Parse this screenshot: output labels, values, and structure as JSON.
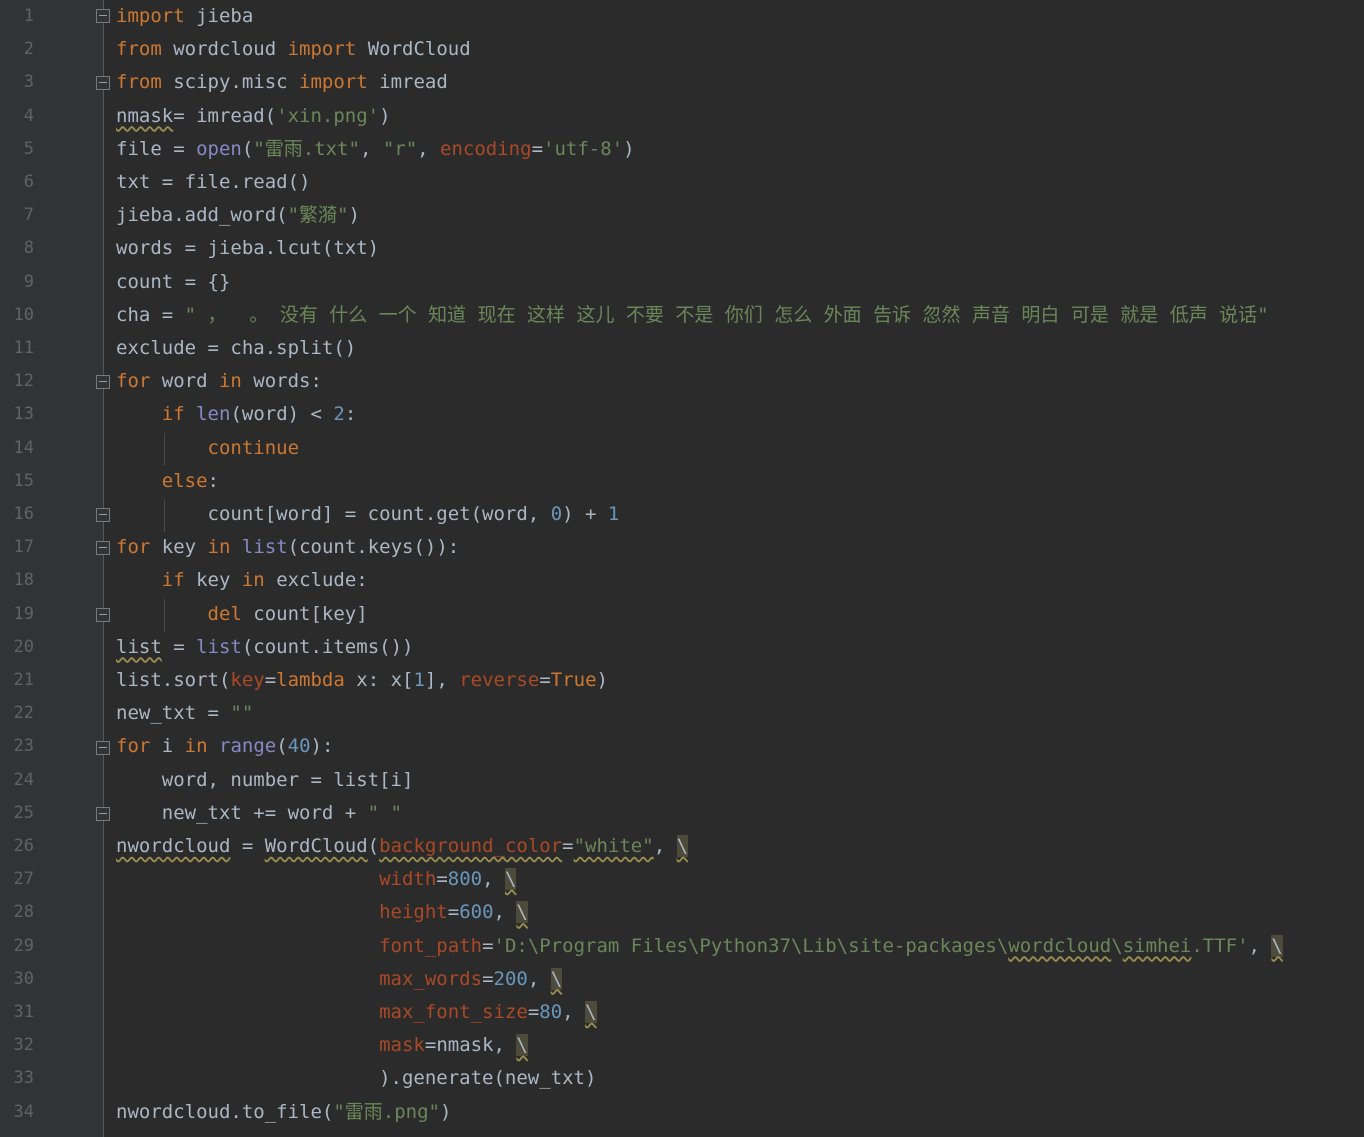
{
  "editor": {
    "line_numbers": [
      "1",
      "2",
      "3",
      "4",
      "5",
      "6",
      "7",
      "8",
      "9",
      "10",
      "11",
      "12",
      "13",
      "14",
      "15",
      "16",
      "17",
      "18",
      "19",
      "20",
      "21",
      "22",
      "23",
      "24",
      "25",
      "26",
      "27",
      "28",
      "29",
      "30",
      "31",
      "32",
      "33",
      "34"
    ],
    "code": {
      "l1": [
        "import",
        " jieba"
      ],
      "l2": [
        "from",
        " wordcloud ",
        "import",
        " WordCloud"
      ],
      "l3": [
        "from",
        " scipy.misc ",
        "import",
        " imread"
      ],
      "l4": [
        "nmask",
        "= imread(",
        "'xin.png'",
        ")"
      ],
      "l5": [
        "file = ",
        "open",
        "(",
        "\"雷雨.txt\"",
        ", ",
        "\"r\"",
        ", ",
        "encoding",
        "=",
        "'utf-8'",
        ")"
      ],
      "l6": [
        "txt = file.read()"
      ],
      "l7": [
        "jieba.add_word(",
        "\"繁漪\"",
        ")"
      ],
      "l8": [
        "words = jieba.lcut(txt)"
      ],
      "l9": [
        "count = {}"
      ],
      "l10": [
        "cha = ",
        "\" ，  。 没有 什么 一个 知道 现在 这样 这儿 不要 不是 你们 怎么 外面 告诉 忽然 声音 明白 可是 就是 低声 说话\""
      ],
      "l11": [
        "exclude = cha.split()"
      ],
      "l12": [
        "for",
        " word ",
        "in",
        " words:"
      ],
      "l13": [
        "    ",
        "if",
        " ",
        "len",
        "(word) < ",
        "2",
        ":"
      ],
      "l14": [
        "        ",
        "continue"
      ],
      "l15": [
        "    ",
        "else",
        ":"
      ],
      "l16": [
        "        count[word] = count.get(word, ",
        "0",
        ") + ",
        "1"
      ],
      "l17": [
        "for",
        " key ",
        "in",
        " ",
        "list",
        "(count.keys()):"
      ],
      "l18": [
        "    ",
        "if",
        " key ",
        "in",
        " exclude:"
      ],
      "l19": [
        "        ",
        "del",
        " count[key]"
      ],
      "l20": [
        "list",
        " = ",
        "list",
        "(count.items())"
      ],
      "l21": [
        "list.sort(",
        "key",
        "=",
        "lambda",
        " x: x[",
        "1",
        "], ",
        "reverse",
        "=",
        "True",
        ")"
      ],
      "l22": [
        "new_txt = ",
        "\"\""
      ],
      "l23": [
        "for",
        " i ",
        "in",
        " ",
        "range",
        "(",
        "40",
        "):"
      ],
      "l24": [
        "    word, number = list[i]"
      ],
      "l25": [
        "    new_txt += word + ",
        "\" \""
      ],
      "l26": [
        "nwordcloud",
        " = ",
        "WordCloud",
        "(",
        "background_color",
        "=",
        "\"white\"",
        ", ",
        "\\"
      ],
      "l27": [
        "                       ",
        "width",
        "=",
        "800",
        ", ",
        "\\"
      ],
      "l28": [
        "                       ",
        "height",
        "=",
        "600",
        ", ",
        "\\"
      ],
      "l29": [
        "                       ",
        "font_path",
        "=",
        "'D:\\Program Files\\Python37\\Lib\\site-packages\\",
        "wordcloud",
        "\\",
        "simhei",
        ".TTF'",
        ", ",
        "\\"
      ],
      "l30": [
        "                       ",
        "max_words",
        "=",
        "200",
        ", ",
        "\\"
      ],
      "l31": [
        "                       ",
        "max_font_size",
        "=",
        "80",
        ", ",
        "\\"
      ],
      "l32": [
        "                       ",
        "mask",
        "=nmask, ",
        "\\"
      ],
      "l33": [
        "                       ).generate(new_txt)"
      ],
      "l34": [
        "nwordcloud.to_file(",
        "\"雷雨.png\"",
        ")"
      ]
    }
  }
}
